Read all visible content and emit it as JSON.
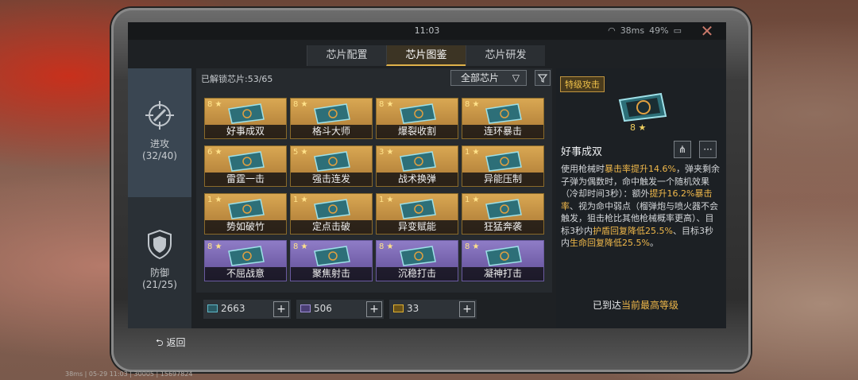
{
  "status": {
    "time": "11:03",
    "net": "38ms",
    "battery": "49%"
  },
  "tabs": [
    {
      "label": "芯片配置"
    },
    {
      "label": "芯片图鉴"
    },
    {
      "label": "芯片研发"
    }
  ],
  "left_nav": {
    "attack_label": "进攻",
    "attack_count": "(32/40)",
    "defense_label": "防御",
    "defense_count": "(21/25)"
  },
  "grid": {
    "unlocked": "已解锁芯片:53/65",
    "filter": "全部芯片",
    "cards": [
      {
        "lv": "8",
        "name": "好事成双",
        "tier": "gold"
      },
      {
        "lv": "8",
        "name": "格斗大师",
        "tier": "gold"
      },
      {
        "lv": "8",
        "name": "爆裂收割",
        "tier": "gold"
      },
      {
        "lv": "8",
        "name": "连环暴击",
        "tier": "gold"
      },
      {
        "lv": "6",
        "name": "雷霆一击",
        "tier": "gold"
      },
      {
        "lv": "5",
        "name": "强击连发",
        "tier": "gold"
      },
      {
        "lv": "3",
        "name": "战术换弹",
        "tier": "gold"
      },
      {
        "lv": "1",
        "name": "异能压制",
        "tier": "gold"
      },
      {
        "lv": "1",
        "name": "势如破竹",
        "tier": "gold"
      },
      {
        "lv": "1",
        "name": "定点击破",
        "tier": "gold"
      },
      {
        "lv": "1",
        "name": "异变赋能",
        "tier": "gold"
      },
      {
        "lv": "1",
        "name": "狂猛奔袭",
        "tier": "gold"
      },
      {
        "lv": "8",
        "name": "不屈战意",
        "tier": "purple"
      },
      {
        "lv": "8",
        "name": "聚焦射击",
        "tier": "purple"
      },
      {
        "lv": "8",
        "name": "沉稳打击",
        "tier": "purple"
      },
      {
        "lv": "8",
        "name": "凝神打击",
        "tier": "purple"
      }
    ]
  },
  "currencies": [
    {
      "value": "2663",
      "color": "#5fb8c8"
    },
    {
      "value": "506",
      "color": "#a090d8"
    },
    {
      "value": "33",
      "color": "#e0b030"
    }
  ],
  "detail": {
    "tag": "特级攻击",
    "level": "8",
    "name": "好事成双",
    "desc_parts": [
      "使用枪械时",
      "暴击率提升14.6%",
      "，弹夹剩余子弹为偶数时，命中触发一个随机效果（冷却时间3秒）：额外",
      "提升16.2%暴击率",
      "、视为命中弱点（榴弹炮与喷火器不会触发，狙击枪比其他枪械概率更高）、目标3秒内",
      "护盾回复降低25.5%",
      "、目标3秒内",
      "生命回复降低25.5%",
      "。"
    ],
    "max1": "已到达",
    "max2": "当前最高等级"
  },
  "back_label": "返回",
  "footer": "38ms | 05-29 11:03 | 30005 | 15697824"
}
